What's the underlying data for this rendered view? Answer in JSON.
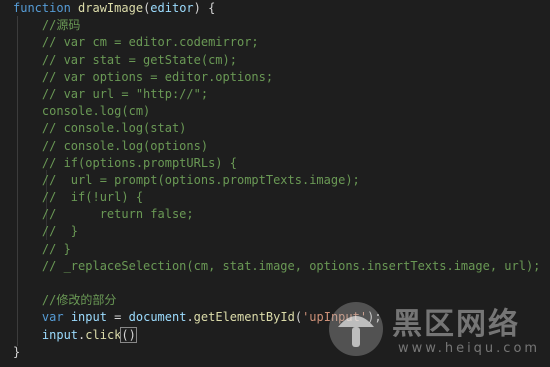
{
  "editor": {
    "lines": [
      [
        {
          "t": "function",
          "c": "kw"
        },
        {
          "t": " ",
          "c": "pl"
        },
        {
          "t": "drawImage",
          "c": "fn"
        },
        {
          "t": "(",
          "c": "pl"
        },
        {
          "t": "editor",
          "c": "var"
        },
        {
          "t": ") {",
          "c": "pl"
        }
      ],
      [
        {
          "t": "    //源码",
          "c": "cm"
        }
      ],
      [
        {
          "t": "    // var cm = editor.codemirror;",
          "c": "cm"
        }
      ],
      [
        {
          "t": "    // var stat = getState(cm);",
          "c": "cm"
        }
      ],
      [
        {
          "t": "    // var options = editor.options;",
          "c": "cm"
        }
      ],
      [
        {
          "t": "    // var url = \"http://\";",
          "c": "cm"
        }
      ],
      [
        {
          "t": "    console.log(cm)",
          "c": "cm"
        }
      ],
      [
        {
          "t": "    // console.log(stat)",
          "c": "cm"
        }
      ],
      [
        {
          "t": "    // console.log(options)",
          "c": "cm"
        }
      ],
      [
        {
          "t": "    // if(options.promptURLs) {",
          "c": "cm"
        }
      ],
      [
        {
          "t": "    //  url = prompt(options.promptTexts.image);",
          "c": "cm"
        }
      ],
      [
        {
          "t": "    //  if(!url) {",
          "c": "cm"
        }
      ],
      [
        {
          "t": "    //      return false;",
          "c": "cm"
        }
      ],
      [
        {
          "t": "    //  }",
          "c": "cm"
        }
      ],
      [
        {
          "t": "    // }",
          "c": "cm"
        }
      ],
      [
        {
          "t": "    // _replaceSelection(cm, stat.image, options.insertTexts.image, url);",
          "c": "cm"
        }
      ],
      [
        {
          "t": "",
          "c": "pl"
        }
      ],
      [
        {
          "t": "    //修改的部分",
          "c": "cm"
        }
      ],
      [
        {
          "t": "    ",
          "c": "pl"
        },
        {
          "t": "var",
          "c": "kw"
        },
        {
          "t": " ",
          "c": "pl"
        },
        {
          "t": "input",
          "c": "var"
        },
        {
          "t": " = ",
          "c": "pl"
        },
        {
          "t": "document",
          "c": "var"
        },
        {
          "t": ".",
          "c": "pl"
        },
        {
          "t": "getElementById",
          "c": "fn"
        },
        {
          "t": "(",
          "c": "pl"
        },
        {
          "t": "'upInput'",
          "c": "str"
        },
        {
          "t": ");",
          "c": "pl"
        }
      ],
      [
        {
          "t": "    ",
          "c": "pl"
        },
        {
          "t": "input",
          "c": "var"
        },
        {
          "t": ".",
          "c": "pl"
        },
        {
          "t": "click",
          "c": "fn"
        },
        {
          "t": "()",
          "c": "pl",
          "box": true
        }
      ],
      [
        {
          "t": "}",
          "c": "pl"
        }
      ]
    ]
  },
  "watermark": {
    "title": "黑区网络",
    "url": "www.heiqu.com"
  }
}
